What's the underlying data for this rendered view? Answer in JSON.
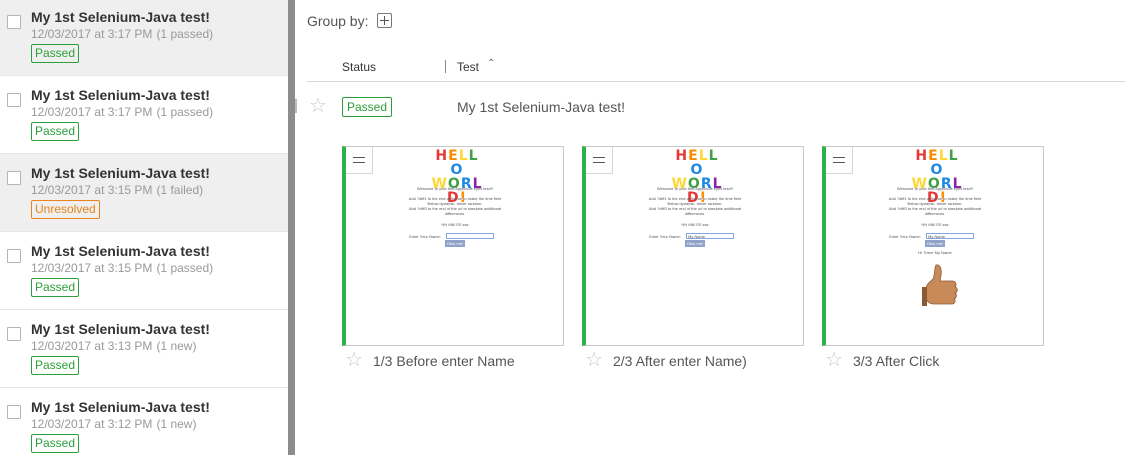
{
  "batches": [
    {
      "name": "My 1st Selenium-Java test!",
      "date": "12/03/2017 at 3:17 PM",
      "count": "(1 passed)",
      "status": "Passed",
      "status_type": "passed"
    },
    {
      "name": "My 1st Selenium-Java test!",
      "date": "12/03/2017 at 3:17 PM",
      "count": "(1 passed)",
      "status": "Passed",
      "status_type": "passed"
    },
    {
      "name": "My 1st Selenium-Java test!",
      "date": "12/03/2017 at 3:15 PM",
      "count": "(1 failed)",
      "status": "Unresolved",
      "status_type": "unresolved"
    },
    {
      "name": "My 1st Selenium-Java test!",
      "date": "12/03/2017 at 3:15 PM",
      "count": "(1 passed)",
      "status": "Passed",
      "status_type": "passed"
    },
    {
      "name": "My 1st Selenium-Java test!",
      "date": "12/03/2017 at 3:13 PM",
      "count": "(1 new)",
      "status": "Passed",
      "status_type": "passed"
    },
    {
      "name": "My 1st Selenium-Java test!",
      "date": "12/03/2017 at 3:12 PM",
      "count": "(1 new)",
      "status": "Passed",
      "status_type": "passed"
    }
  ],
  "toolbar": {
    "group_by_label": "Group by:"
  },
  "table": {
    "status_header": "Status",
    "test_header": "Test"
  },
  "test_row": {
    "status": "Passed",
    "name": "My 1st Selenium-Java test!"
  },
  "steps": [
    {
      "label": "1/3 Before enter Name",
      "input_value": "",
      "greeting": "",
      "has_thumb": false
    },
    {
      "label": "2/3 After enter Name)",
      "input_value": "My Name",
      "greeting": "",
      "has_thumb": false
    },
    {
      "label": "3/3 After Click",
      "input_value": "My Name",
      "greeting": "Hi There My Name",
      "has_thumb": true
    }
  ],
  "snapshot": {
    "hello": "HELLO",
    "world": "WORLD!",
    "welcome": "Welcome to your first Applitools eyes test!!!",
    "line1": "Add ?diff1 to the end of the url to make the time field",
    "line2": "Below dynamic. driver random.",
    "line3": "Add ?diff2 to the end of the url to simulate additional",
    "line4": "differences.",
    "time": "HH MM SS sss",
    "input_label": "Enter Your Name:",
    "button_label": "Click me!"
  },
  "colors": {
    "passed": "#2d9f3a",
    "unresolved": "#e8841b",
    "thumb_border": "#2db14a",
    "divider": "#8c8c8c"
  }
}
